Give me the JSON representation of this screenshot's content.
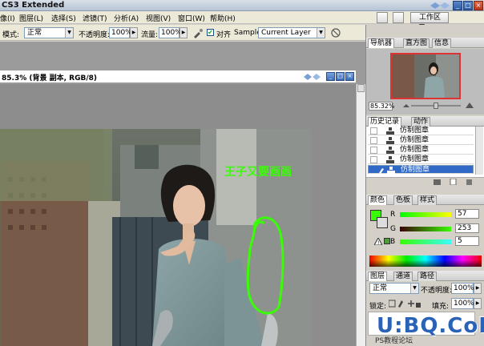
{
  "app": {
    "title": "CS3 Extended"
  },
  "menu": [
    "像(I)",
    "图层(L)",
    "选择(S)",
    "滤镜(T)",
    "分析(A)",
    "视图(V)",
    "窗口(W)",
    "帮助(H)"
  ],
  "workspace_button": "工作区 ▼",
  "options": {
    "mode_label": "模式:",
    "mode_value": "正常",
    "opacity_label": "不透明度:",
    "opacity_value": "100%",
    "flow_label": "流量:",
    "flow_value": "100%",
    "aligned_label": "对齐",
    "sample_label": "Sample:",
    "sample_value": "Current Layer"
  },
  "document": {
    "title": "85.3% (背景 副本, RGB/8)",
    "overlay_text": "王子又要画画"
  },
  "navigator": {
    "tabs": [
      "导航器",
      "直方图",
      "信息"
    ],
    "zoom": "85.32%"
  },
  "history": {
    "tabs": [
      "历史记录",
      "动作"
    ],
    "items": [
      "仿制图章",
      "仿制图章",
      "仿制图章",
      "仿制图章",
      "仿制图章"
    ]
  },
  "color": {
    "tabs": [
      "颜色",
      "色板",
      "样式"
    ],
    "channels": [
      {
        "label": "R",
        "value": "57"
      },
      {
        "label": "G",
        "value": "253"
      },
      {
        "label": "B",
        "value": "5"
      }
    ],
    "foreground": "#39fd05"
  },
  "layers": {
    "tabs": [
      "图层",
      "通道",
      "路径"
    ],
    "blend_mode": "正常",
    "opacity_label": "不透明度:",
    "opacity_value": "100%",
    "lock_label": "锁定:",
    "fill_label": "填充:",
    "fill_value": "100%"
  },
  "watermark": {
    "text": "U:BQ.CoM",
    "sub": "PS教程论坛"
  }
}
